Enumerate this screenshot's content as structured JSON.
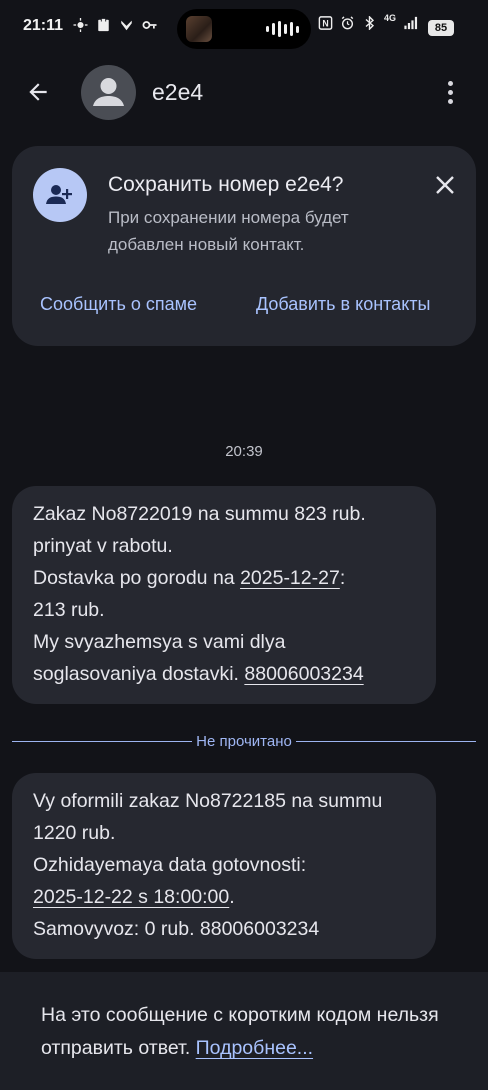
{
  "status_bar": {
    "time": "21:11",
    "network_label": "4G",
    "battery": "85",
    "left_icons": [
      "sun-icon",
      "clipboard-icon",
      "app-notification-icon",
      "key-icon"
    ],
    "right_icons": [
      "nfc-icon",
      "alarm-icon",
      "bluetooth-icon",
      "signal-icon"
    ]
  },
  "app_bar": {
    "contact_name": "e2e4",
    "icons": [
      "back-arrow-icon",
      "person-icon",
      "more-vert-icon"
    ]
  },
  "save_card": {
    "title": "Сохранить номер e2e4?",
    "text": "При сохранении номера будет добавлен новый контакт.",
    "report_spam": "Сообщить о спаме",
    "add_contact": "Добавить в контакты",
    "icon": "add-person-icon",
    "accent_color": "#b7c8f5"
  },
  "conversation": {
    "timestamp": "20:39",
    "unread_label": "Не прочитано",
    "messages": [
      {
        "line1": "Zakaz No8722019 na summu 823 rub.",
        "line2": "prinyat v rabotu.",
        "line3_prefix": "Dostavka po gorodu na ",
        "date_link": "2025-12-27",
        "line3_suffix": ":",
        "line4": "213 rub.",
        "line5": "My svyazhemsya s vami dlya",
        "line6_prefix": "soglasovaniya dostavki. ",
        "phone_link": "88006003234"
      },
      {
        "line1": "Vy oformili zakaz No8722185 na summu",
        "line2": "1220 rub.",
        "line3": "Ozhidayemaya data gotovnosti:",
        "date_link": "2025-12-22 s 18:00:00",
        "line4_suffix": ".",
        "line5": "Samovyvoz: 0 rub. 88006003234"
      }
    ]
  },
  "footer": {
    "notice": "На это сообщение с коротким кодом нельзя отправить ответ. ",
    "link": "Подробнее..."
  }
}
